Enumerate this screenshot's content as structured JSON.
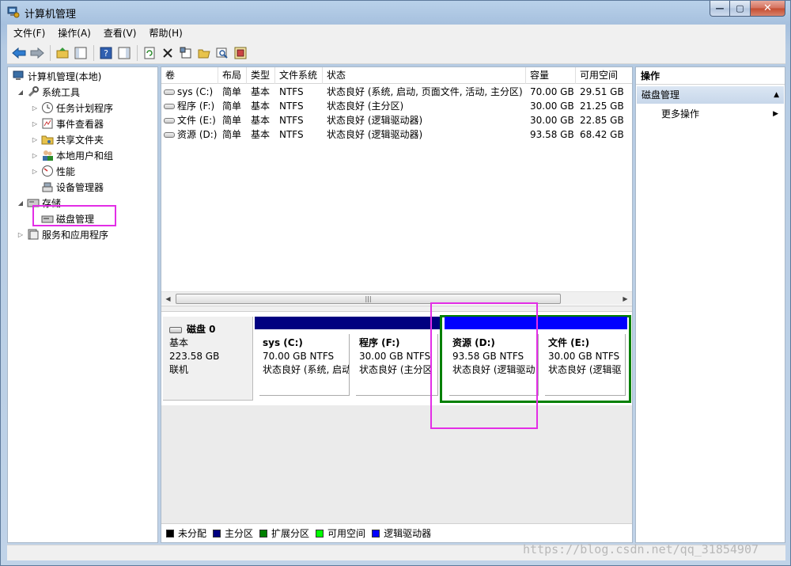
{
  "window": {
    "title": "计算机管理"
  },
  "window_controls": {
    "minimize": "—",
    "maximize": "▢",
    "close": "✕"
  },
  "menu": [
    "文件(F)",
    "操作(A)",
    "查看(V)",
    "帮助(H)"
  ],
  "tree": {
    "root": "计算机管理(本地)",
    "system_tools": "系统工具",
    "items_system": [
      "任务计划程序",
      "事件查看器",
      "共享文件夹",
      "本地用户和组",
      "性能",
      "设备管理器"
    ],
    "storage": "存储",
    "disk_management": "磁盘管理",
    "services": "服务和应用程序"
  },
  "volume_table": {
    "columns": [
      "卷",
      "布局",
      "类型",
      "文件系统",
      "状态",
      "容量",
      "可用空间"
    ],
    "rows": [
      [
        "sys (C:)",
        "简单",
        "基本",
        "NTFS",
        "状态良好 (系统, 启动, 页面文件, 活动, 主分区)",
        "70.00 GB",
        "29.51 GB"
      ],
      [
        "程序 (F:)",
        "简单",
        "基本",
        "NTFS",
        "状态良好 (主分区)",
        "30.00 GB",
        "21.25 GB"
      ],
      [
        "文件 (E:)",
        "简单",
        "基本",
        "NTFS",
        "状态良好 (逻辑驱动器)",
        "30.00 GB",
        "22.85 GB"
      ],
      [
        "资源 (D:)",
        "简单",
        "基本",
        "NTFS",
        "状态良好 (逻辑驱动器)",
        "93.58 GB",
        "68.42 GB"
      ]
    ]
  },
  "scrollbar": {
    "left": "◀",
    "right": "▶",
    "grip": "|||"
  },
  "disk": {
    "name": "磁盘 0",
    "type": "基本",
    "size": "223.58 GB",
    "status": "联机",
    "partitions": [
      {
        "title": "sys  (C:)",
        "size": "70.00 GB NTFS",
        "status": "状态良好 (系统, 启动",
        "bar_color": "#000080"
      },
      {
        "title": "程序  (F:)",
        "size": "30.00 GB NTFS",
        "status": "状态良好 (主分区",
        "bar_color": "#000080"
      },
      {
        "title": "资源  (D:)",
        "size": "93.58 GB NTFS",
        "status": "状态良好 (逻辑驱动",
        "bar_color": "#0000ff"
      },
      {
        "title": "文件  (E:)",
        "size": "30.00 GB NTFS",
        "status": "状态良好 (逻辑驱",
        "bar_color": "#0000ff"
      }
    ]
  },
  "legend": [
    {
      "label": "未分配",
      "color": "#000000"
    },
    {
      "label": "主分区",
      "color": "#000080"
    },
    {
      "label": "扩展分区",
      "color": "#008000"
    },
    {
      "label": "可用空间",
      "color": "#00ff00"
    },
    {
      "label": "逻辑驱动器",
      "color": "#0000ff"
    }
  ],
  "actions": {
    "header": "操作",
    "section": "磁盘管理",
    "more": "更多操作"
  },
  "watermark": "https://blog.csdn.net/qq_31854907",
  "colors": {
    "highlight": "#e32ee6",
    "extended_frame": "#008000"
  }
}
